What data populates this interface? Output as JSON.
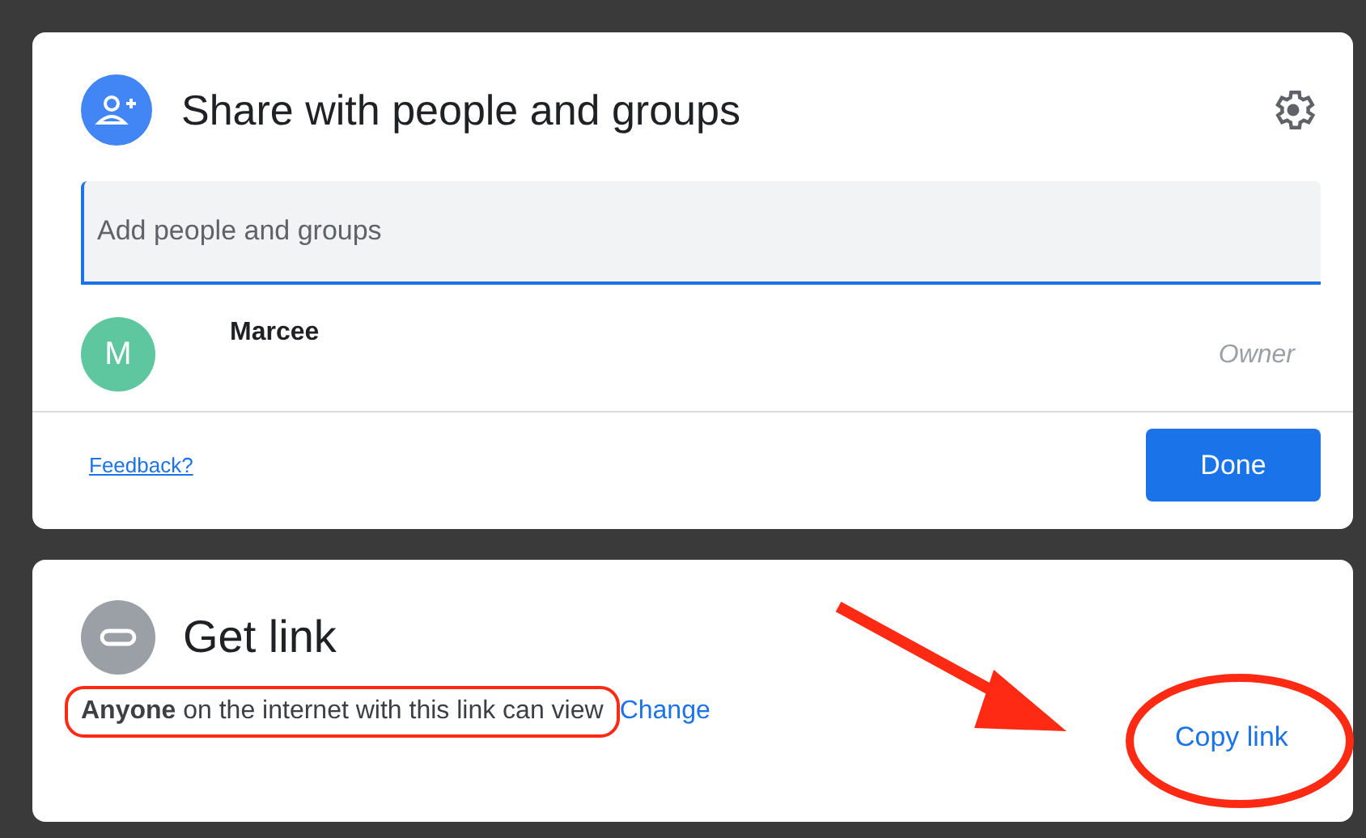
{
  "share_dialog": {
    "title": "Share with people and groups",
    "search": {
      "placeholder": "Add people and groups"
    },
    "people": [
      {
        "initial": "M",
        "name": "Marcee",
        "role": "Owner"
      }
    ],
    "feedback_link": "Feedback?",
    "done_button": "Done"
  },
  "link_dialog": {
    "title": "Get link",
    "access_text": "**Anyone** on the internet with this link can view",
    "change_link": "Change",
    "copy_link": "Copy link"
  }
}
